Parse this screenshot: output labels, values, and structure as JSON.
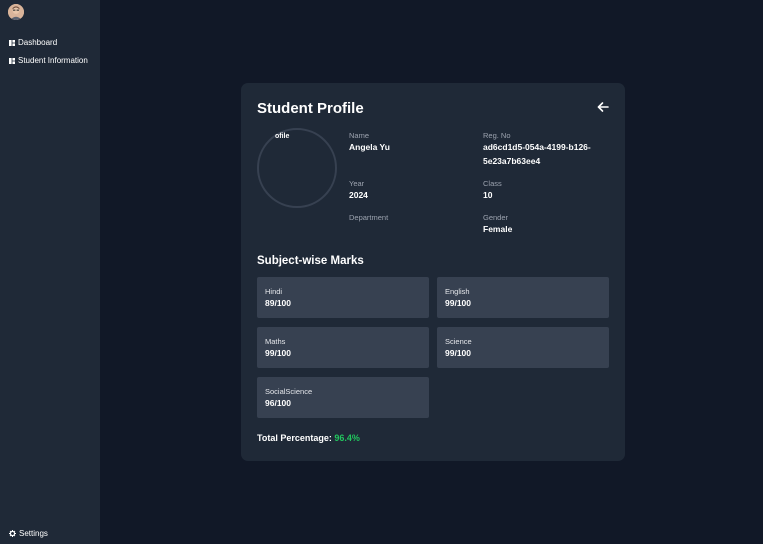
{
  "sidebar": {
    "items": [
      {
        "label": "Dashboard",
        "icon": "dashboard-icon"
      },
      {
        "label": "Student Information",
        "icon": "student-info-icon"
      }
    ],
    "settings_label": "Settings"
  },
  "profile": {
    "title": "Student Profile",
    "image_alt": "ofile",
    "fields": {
      "name": {
        "label": "Name",
        "value": "Angela Yu"
      },
      "reg": {
        "label": "Reg. No",
        "value_line1": "ad6cd1d5-054a-4199-b126-",
        "value_line2": "5e23a7b63ee4"
      },
      "year": {
        "label": "Year",
        "value": "2024"
      },
      "class": {
        "label": "Class",
        "value": "10"
      },
      "department": {
        "label": "Department",
        "value": ""
      },
      "gender": {
        "label": "Gender",
        "value": "Female"
      }
    }
  },
  "marks": {
    "title": "Subject-wise Marks",
    "subjects": [
      {
        "name": "Hindi",
        "score": "89/100"
      },
      {
        "name": "English",
        "score": "99/100"
      },
      {
        "name": "Maths",
        "score": "99/100"
      },
      {
        "name": "Science",
        "score": "99/100"
      },
      {
        "name": "SocialScience",
        "score": "96/100"
      }
    ],
    "total_label": "Total Percentage:",
    "total_value": "96.4%"
  },
  "colors": {
    "accent_green": "#22c55e",
    "card_bg": "#1f2937",
    "page_bg": "#111827",
    "mark_bg": "#374151"
  }
}
